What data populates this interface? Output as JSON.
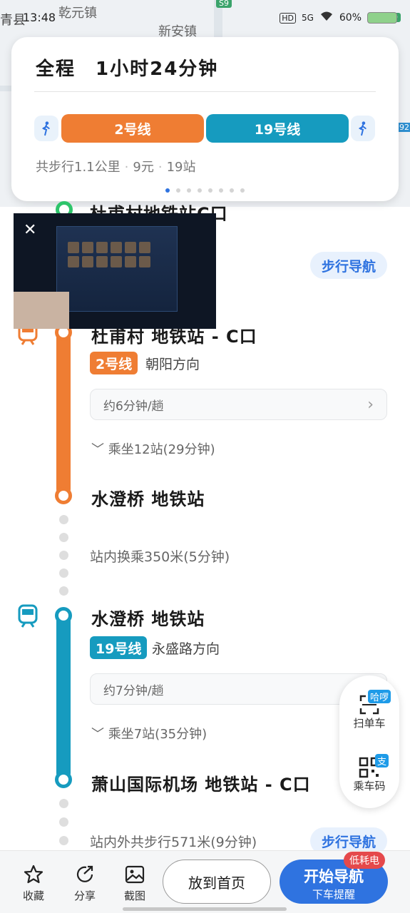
{
  "status_bar": {
    "time": "13:48",
    "left_town": "青县",
    "battery": "60%",
    "network": "5G",
    "hd": "HD"
  },
  "map": {
    "labels": [
      "乾元镇",
      "新安镇"
    ],
    "road_badges": [
      "S9",
      "S9",
      "92"
    ]
  },
  "summary": {
    "total_label": "全程",
    "duration": "1小时24分钟",
    "segments": [
      {
        "label": "2号线",
        "color": "#ef7d33"
      },
      {
        "label": "19号线",
        "color": "#169bbf"
      }
    ],
    "walk_distance": "共步行1.1公里",
    "price": "9元",
    "stops": "19站",
    "page_dots": 8,
    "active_dot": 0
  },
  "timeline": {
    "start_station": "杜甫村地铁站C口",
    "walk_nav_label": "步行导航",
    "leg1": {
      "board_station": "杜甫村 地铁站 - C口",
      "line": "2号线",
      "direction": "朝阳方向",
      "frequency": "约6分钟/趟",
      "ride": "乘坐12站(29分钟)",
      "alight_station": "水澄桥 地铁站",
      "color": "#ef7d33"
    },
    "transfer": "站内换乘350米(5分钟)",
    "leg2": {
      "board_station": "水澄桥 地铁站",
      "line": "19号线",
      "direction": "永盛路方向",
      "frequency": "约7分钟/趟",
      "ride": "乘坐7站(35分钟)",
      "alight_station": "萧山国际机场 地铁站 - C口",
      "color": "#169bbf"
    },
    "final_walk": "站内外共步行571米(9分钟)"
  },
  "side_widget": {
    "scan_label": "扫单车",
    "scan_badge": "哈啰",
    "ride_code_label": "乘车码",
    "ride_code_badge": "支"
  },
  "bottom_bar": {
    "collect": "收藏",
    "share": "分享",
    "screenshot": "截图",
    "home": "放到首页",
    "start": "开始导航",
    "start_sub": "下车提醒",
    "low_power": "低耗电"
  }
}
